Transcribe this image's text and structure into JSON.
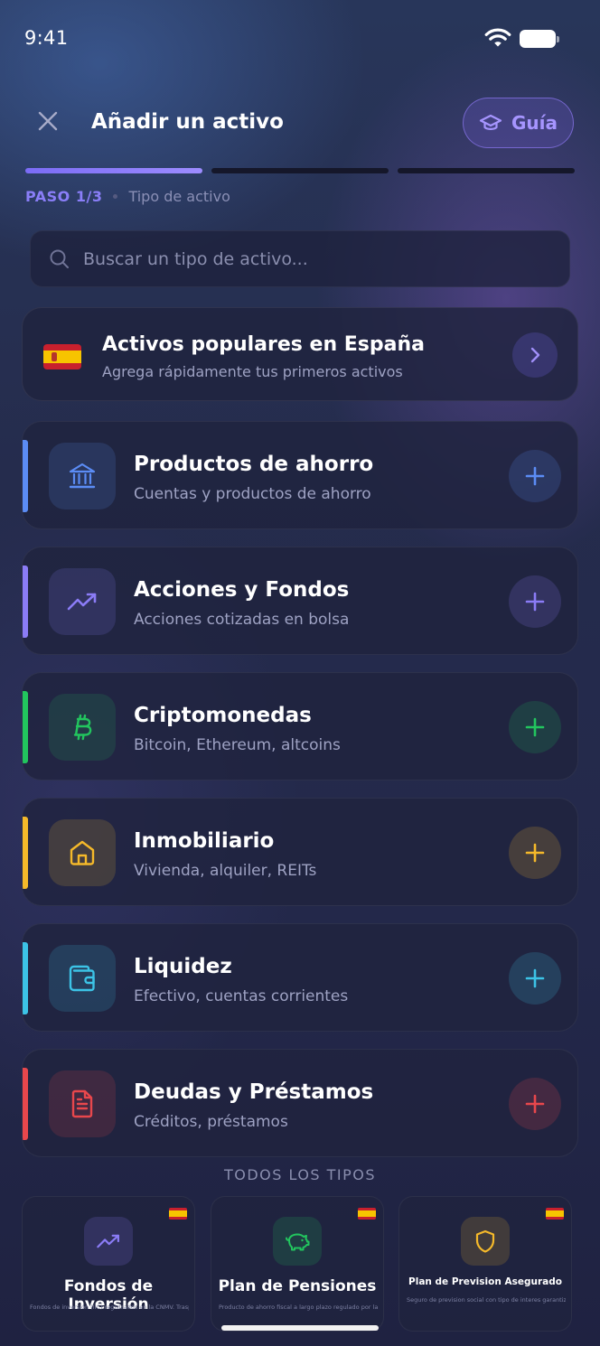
{
  "status_bar": {
    "time": "9:41"
  },
  "header": {
    "title": "Añadir un activo",
    "guide_label": "Guía"
  },
  "progress": {
    "current": 1,
    "total": 3
  },
  "step": {
    "number": "PASO 1/3",
    "label": "Tipo de activo"
  },
  "search": {
    "placeholder": "Buscar un tipo de activo..."
  },
  "popular": {
    "title": "Activos populares en España",
    "subtitle": "Agrega rápidamente tus primeros activos",
    "flag": "spain-flag-icon"
  },
  "categories": [
    {
      "title": "Productos de ahorro",
      "subtitle": "Cuentas y productos de ahorro",
      "icon": "bank-icon",
      "color": "#5b8cf5"
    },
    {
      "title": "Acciones y Fondos",
      "subtitle": "Acciones cotizadas en bolsa",
      "icon": "trending-up-icon",
      "color": "#8b7cf6"
    },
    {
      "title": "Criptomonedas",
      "subtitle": "Bitcoin, Ethereum, altcoins",
      "icon": "bitcoin-icon",
      "color": "#22c55e"
    },
    {
      "title": "Inmobiliario",
      "subtitle": "Vivienda, alquiler, REITs",
      "icon": "house-icon",
      "color": "#f5b92a"
    },
    {
      "title": "Liquidez",
      "subtitle": "Efectivo, cuentas corrientes",
      "icon": "wallet-icon",
      "color": "#3cc3e6"
    },
    {
      "title": "Deudas y Préstamos",
      "subtitle": "Créditos, préstamos",
      "icon": "document-icon",
      "color": "#e8474c"
    }
  ],
  "all_types": {
    "label": "TODOS LOS TIPOS",
    "items": [
      {
        "title": "Fondos de Inversión",
        "desc": "Fondos de inversión (IIC) registrados en la CNMV. Traspasables",
        "icon": "trending-up-icon",
        "color": "#8b7cf6"
      },
      {
        "title": "Plan de Pensiones",
        "desc": "Producto de ahorro fiscal a largo plazo regulado por la DGSFP.",
        "icon": "piggy-bank-icon",
        "color": "#22c55e"
      },
      {
        "title": "Plan de Prevision Asegurado",
        "desc": "Seguro de prevision social con tipo de interes garantizado y",
        "icon": "shield-icon",
        "color": "#f5b92a"
      }
    ]
  }
}
